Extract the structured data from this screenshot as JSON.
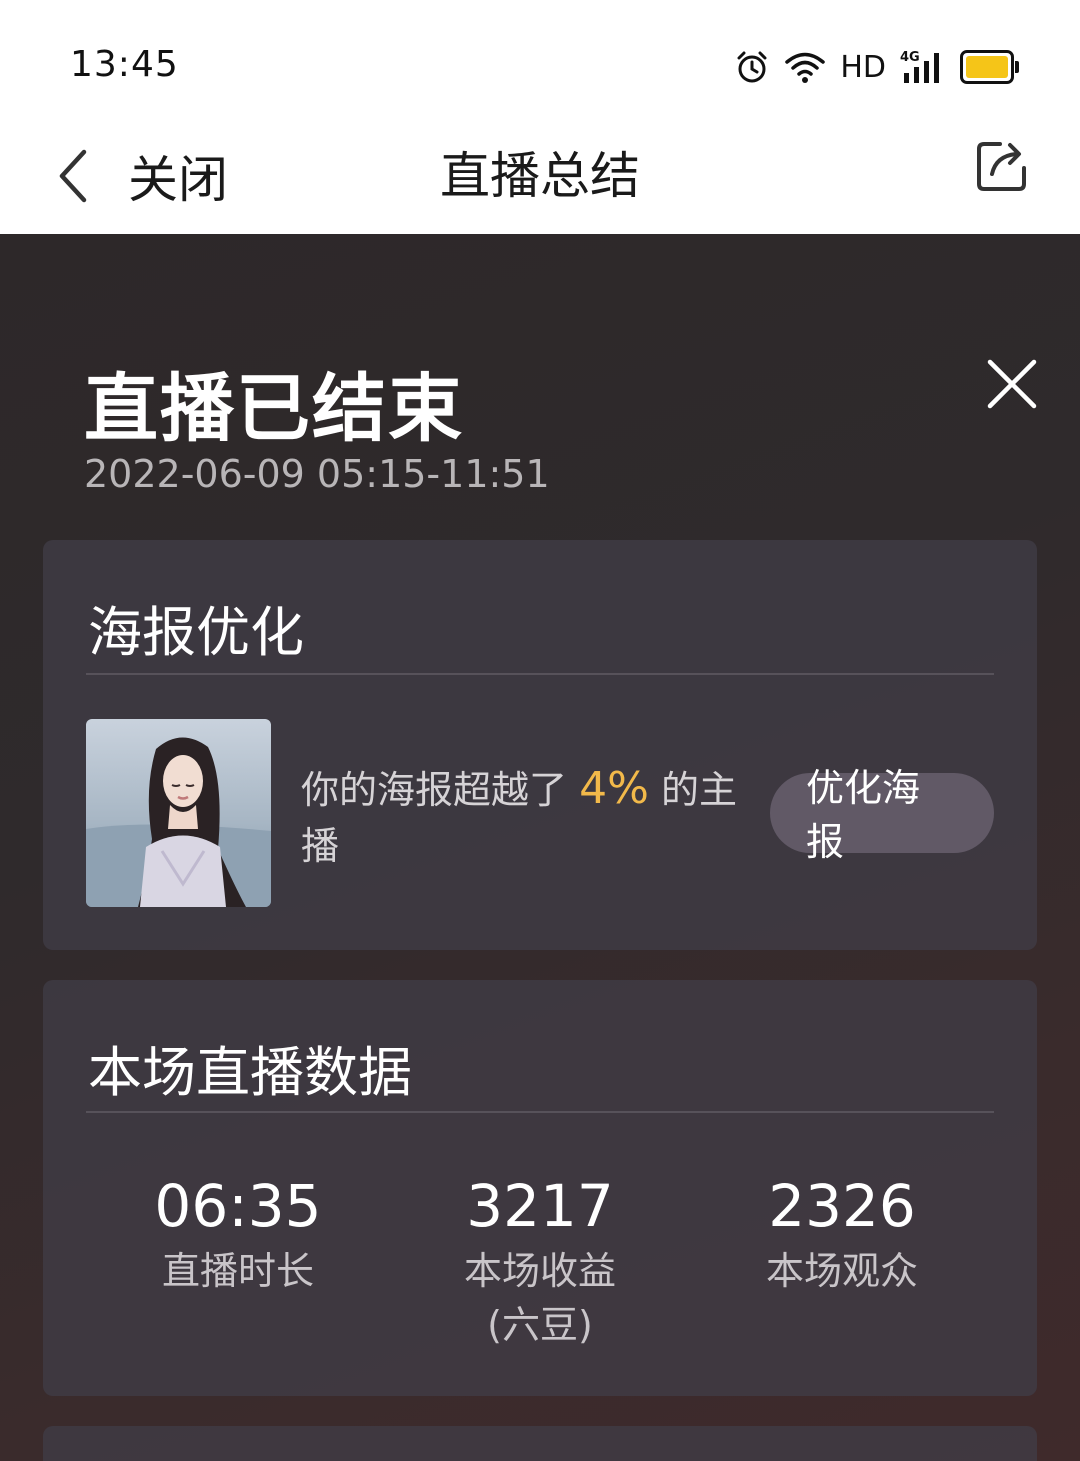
{
  "status_bar": {
    "time": "13:45",
    "hd": "HD",
    "network": "4G",
    "icons": [
      "alarm-icon",
      "wifi-icon",
      "signal-icon",
      "battery-icon"
    ],
    "battery_color": "#f5c518"
  },
  "nav": {
    "back_label": "关闭",
    "title": "直播总结",
    "share_icon": "share-icon"
  },
  "summary": {
    "title": "直播已结束",
    "time_range": "2022-06-09 05:15-11:51"
  },
  "poster": {
    "title": "海报优化",
    "text_before": "你的海报超越了",
    "percent": "4%",
    "text_after": "的主播",
    "button_label": "优化海报",
    "accent_color": "#f2b94a"
  },
  "stats": {
    "title": "本场直播数据",
    "items": [
      {
        "value": "06:35",
        "label": "直播时长"
      },
      {
        "value": "3217",
        "label": "本场收益\n(六豆)"
      },
      {
        "value": "2326",
        "label": "本场观众"
      }
    ]
  }
}
